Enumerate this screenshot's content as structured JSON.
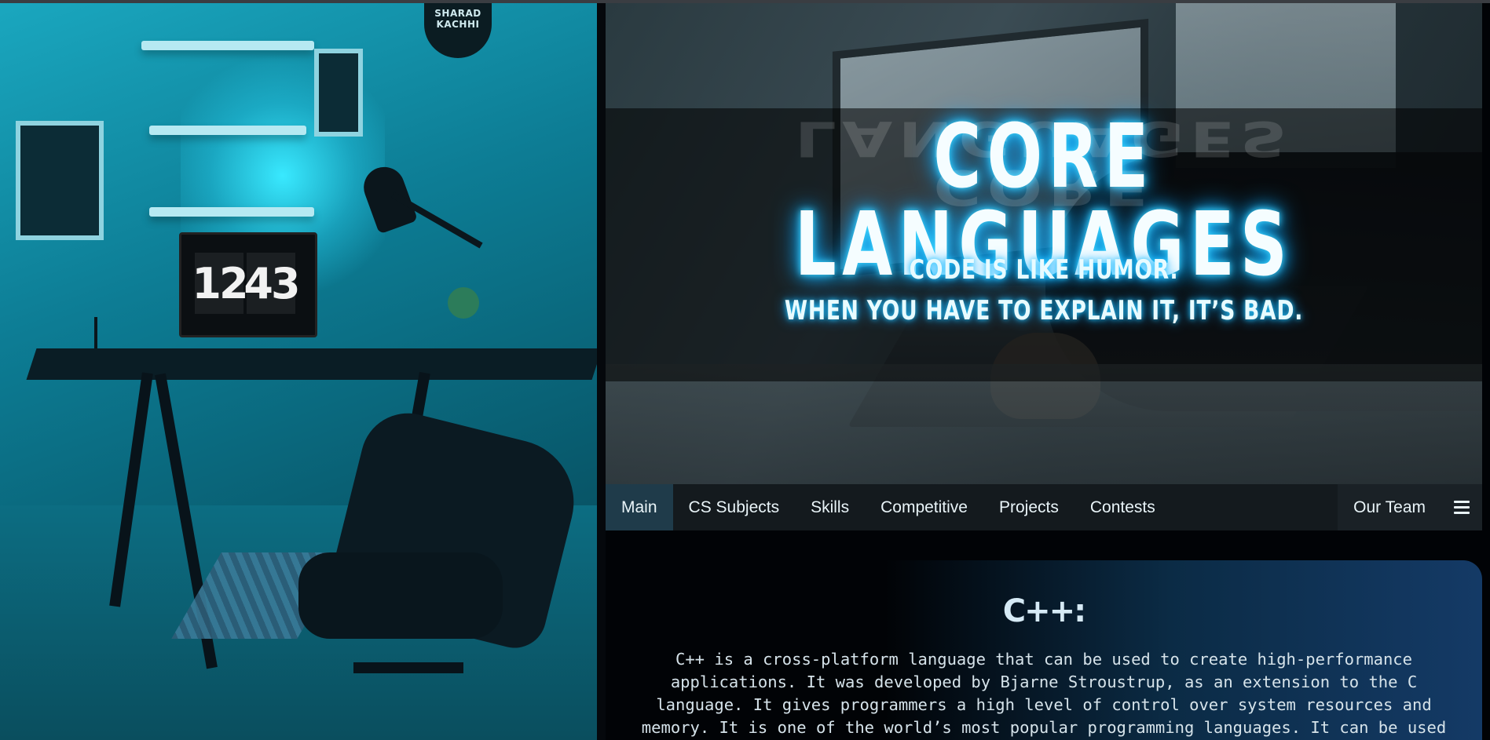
{
  "window": {
    "topline_color": "#3a3d42"
  },
  "left_photo": {
    "poster_text": "SHARAD KACHHI",
    "clock_hours": "12",
    "clock_minutes": "43"
  },
  "hero": {
    "title": "CORE LANGUAGES",
    "tagline_line1": "CODE IS LIKE HUMOR.",
    "tagline_line2": "WHEN YOU HAVE TO EXPLAIN IT, IT’S BAD.",
    "glow_color": "#19b6ff"
  },
  "nav": {
    "items": [
      {
        "label": "Main",
        "active": true
      },
      {
        "label": "CS Subjects"
      },
      {
        "label": "Skills"
      },
      {
        "label": "Competitive"
      },
      {
        "label": "Projects"
      },
      {
        "label": "Contests"
      }
    ],
    "right_item": "Our Team",
    "menu_icon": "hamburger-icon"
  },
  "content": {
    "logo_text": "C++:",
    "description": "C++ is a cross-platform language that can be used to create high-performance applications. It was developed by Bjarne Stroustrup, as an extension to the C language. It gives programmers a high level of control over system resources and memory. It is one of the world’s most popular programming languages. It can be used to develop operating systems, browsers, games, and so"
  }
}
